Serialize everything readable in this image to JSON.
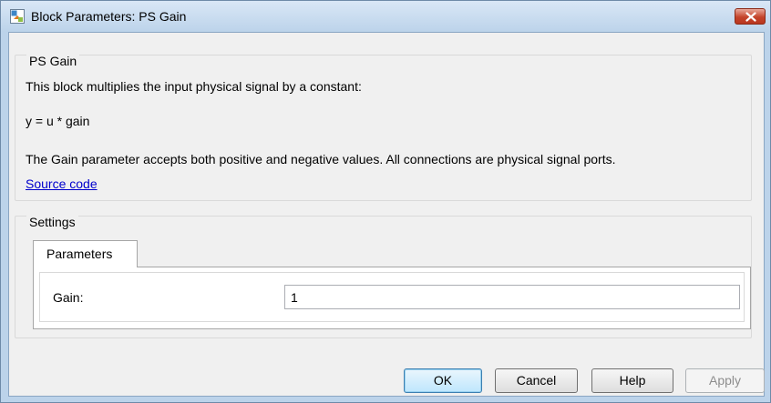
{
  "window": {
    "title": "Block Parameters: PS Gain"
  },
  "description_group": {
    "label": "PS Gain",
    "lines": [
      "This block multiplies the input physical signal by a constant:",
      "y = u * gain",
      "The Gain parameter accepts both positive and negative values. All connections are physical signal ports."
    ],
    "source_link": "Source code"
  },
  "settings_group": {
    "label": "Settings",
    "tabs": [
      {
        "label": "Parameters",
        "selected": true
      }
    ],
    "parameters": [
      {
        "label": "Gain:",
        "value": "1"
      }
    ]
  },
  "buttons": {
    "ok": "OK",
    "cancel": "Cancel",
    "help": "Help",
    "apply": "Apply"
  },
  "colors": {
    "frame": "#bcd3ea",
    "close_button": "#c4442b",
    "link": "#0000cc",
    "dialog_background": "#f0f0f0"
  },
  "icons": {
    "app": "simulink-block-icon",
    "close": "close-icon"
  }
}
